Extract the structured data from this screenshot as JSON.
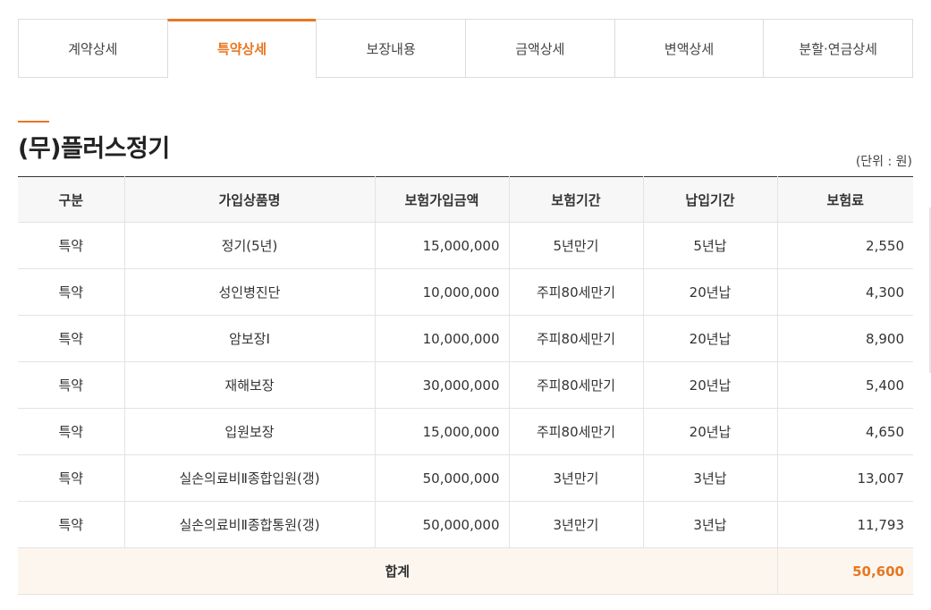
{
  "tabs": [
    {
      "label": "계약상세",
      "active": false
    },
    {
      "label": "특약상세",
      "active": true
    },
    {
      "label": "보장내용",
      "active": false
    },
    {
      "label": "금액상세",
      "active": false
    },
    {
      "label": "변액상세",
      "active": false
    },
    {
      "label": "분할·연금상세",
      "active": false
    }
  ],
  "section": {
    "title": "(무)플러스정기",
    "unit": "(단위 : 원)"
  },
  "table": {
    "headers": [
      "구분",
      "가입상품명",
      "보험가입금액",
      "보험기간",
      "납입기간",
      "보험료"
    ],
    "rows": [
      [
        "특약",
        "정기(5년)",
        "15,000,000",
        "5년만기",
        "5년납",
        "2,550"
      ],
      [
        "특약",
        "성인병진단",
        "10,000,000",
        "주피80세만기",
        "20년납",
        "4,300"
      ],
      [
        "특약",
        "암보장Ⅰ",
        "10,000,000",
        "주피80세만기",
        "20년납",
        "8,900"
      ],
      [
        "특약",
        "재해보장",
        "30,000,000",
        "주피80세만기",
        "20년납",
        "5,400"
      ],
      [
        "특약",
        "입원보장",
        "15,000,000",
        "주피80세만기",
        "20년납",
        "4,650"
      ],
      [
        "특약",
        "실손의료비Ⅱ종합입원(갱)",
        "50,000,000",
        "3년만기",
        "3년납",
        "13,007"
      ],
      [
        "특약",
        "실손의료비Ⅱ종합통원(갱)",
        "50,000,000",
        "3년만기",
        "3년납",
        "11,793"
      ]
    ],
    "total_label": "합계",
    "total_value": "50,600"
  },
  "colors": {
    "accent": "#e87722",
    "total_row_bg": "#fdf6ef",
    "header_bg": "#f7f7f7"
  }
}
